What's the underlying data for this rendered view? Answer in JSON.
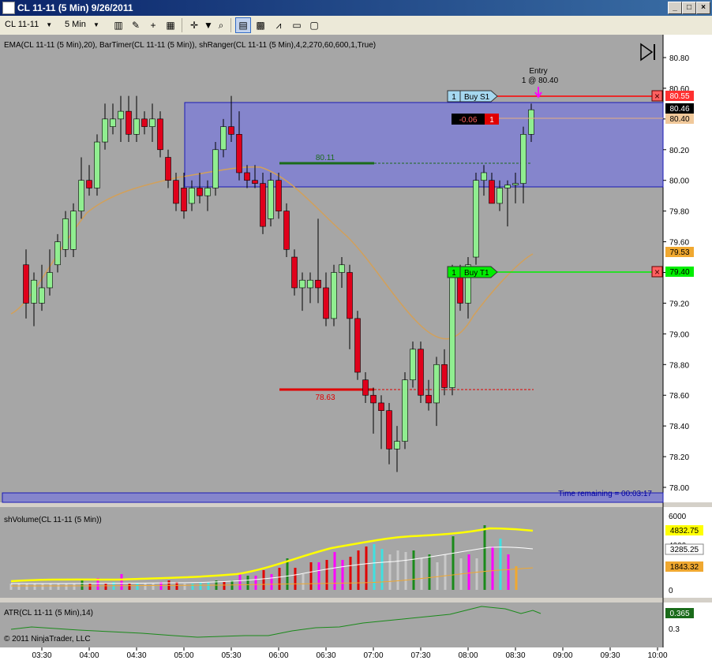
{
  "window": {
    "title": "CL 11-11 (5 Min)  9/26/2011",
    "minimize": "_",
    "maximize": "□",
    "close": "×"
  },
  "toolbar": {
    "instrument": "CL 11-11",
    "interval": "5 Min"
  },
  "price_panel": {
    "indicator_label": "EMA(CL 11-11 (5 Min),20), BarTimer(CL 11-11 (5 Min)), shRanger(CL 11-11 (5 Min),4,2,270,60,600,1,True)",
    "entry_label": "Entry",
    "entry_detail": "1 @ 80.40",
    "buy_s1": {
      "qty": "1",
      "label": "Buy S1",
      "price": "80.55"
    },
    "buy_t1": {
      "qty": "1",
      "label": "Buy T1",
      "price": "79.40"
    },
    "position": {
      "pnl": "-0.06",
      "qty": "1",
      "price": "80.40"
    },
    "last_price": "80.46",
    "ema_price": "79.53",
    "level_high": "80.11",
    "level_low": "78.63",
    "time_remaining": "Time remaining = 00:03:17",
    "y_ticks": [
      "80.80",
      "80.60",
      "80.40",
      "80.20",
      "80.00",
      "79.80",
      "79.60",
      "79.40",
      "79.20",
      "79.00",
      "78.80",
      "78.60",
      "78.40",
      "78.20",
      "78.00"
    ]
  },
  "volume_panel": {
    "label": "shVolume(CL 11-11 (5 Min))",
    "y_ticks": [
      "6000",
      "4000",
      "2000",
      "0"
    ],
    "yellow_value": "4832.75",
    "white_value": "3285.25",
    "orange_value": "1843.32"
  },
  "atr_panel": {
    "label": "ATR(CL 11-11 (5 Min),14)",
    "value": "0.365",
    "tick": "0.3",
    "copyright": "© 2011 NinjaTrader, LLC"
  },
  "x_ticks": [
    "03:30",
    "04:00",
    "04:30",
    "05:00",
    "05:30",
    "06:00",
    "06:30",
    "07:00",
    "07:30",
    "08:00",
    "08:30",
    "09:00",
    "09:30",
    "10:00"
  ],
  "colors": {
    "background": "#a6a6a6",
    "up_candle": "#90ee90",
    "down_candle": "#e0001b",
    "ema": "#d2a05a",
    "range_box": "#8080c8",
    "buy_target": "#00ff00",
    "stop": "#ff0000"
  },
  "chart_data": {
    "type": "candlestick",
    "ylim": [
      77.9,
      80.9
    ],
    "x_range": [
      "03:20",
      "10:05"
    ],
    "candles": [
      {
        "t": "03:20",
        "o": 79.45,
        "h": 79.55,
        "l": 79.1,
        "c": 79.2
      },
      {
        "t": "03:25",
        "o": 79.2,
        "h": 79.4,
        "l": 79.05,
        "c": 79.35
      },
      {
        "t": "03:30",
        "o": 79.2,
        "h": 79.45,
        "l": 79.15,
        "c": 79.3
      },
      {
        "t": "03:35",
        "o": 79.3,
        "h": 79.55,
        "l": 79.25,
        "c": 79.4
      },
      {
        "t": "03:40",
        "o": 79.45,
        "h": 79.65,
        "l": 79.4,
        "c": 79.6
      },
      {
        "t": "03:45",
        "o": 79.55,
        "h": 79.8,
        "l": 79.5,
        "c": 79.75
      },
      {
        "t": "03:50",
        "o": 79.55,
        "h": 79.85,
        "l": 79.5,
        "c": 79.8
      },
      {
        "t": "03:55",
        "o": 79.8,
        "h": 80.15,
        "l": 79.75,
        "c": 80.0
      },
      {
        "t": "04:00",
        "o": 80.0,
        "h": 80.1,
        "l": 79.9,
        "c": 79.95
      },
      {
        "t": "04:05",
        "o": 79.95,
        "h": 80.3,
        "l": 79.9,
        "c": 80.25
      },
      {
        "t": "04:10",
        "o": 80.25,
        "h": 80.5,
        "l": 80.2,
        "c": 80.4
      },
      {
        "t": "04:15",
        "o": 80.35,
        "h": 80.5,
        "l": 80.3,
        "c": 80.4
      },
      {
        "t": "04:20",
        "o": 80.4,
        "h": 80.55,
        "l": 80.25,
        "c": 80.45
      },
      {
        "t": "04:25",
        "o": 80.45,
        "h": 80.55,
        "l": 80.25,
        "c": 80.3
      },
      {
        "t": "04:30",
        "o": 80.3,
        "h": 80.55,
        "l": 80.25,
        "c": 80.4
      },
      {
        "t": "04:35",
        "o": 80.4,
        "h": 80.45,
        "l": 80.3,
        "c": 80.35
      },
      {
        "t": "04:40",
        "o": 80.35,
        "h": 80.5,
        "l": 80.25,
        "c": 80.4
      },
      {
        "t": "04:45",
        "o": 80.4,
        "h": 80.45,
        "l": 80.15,
        "c": 80.2
      },
      {
        "t": "04:50",
        "o": 80.15,
        "h": 80.2,
        "l": 79.95,
        "c": 80.0
      },
      {
        "t": "04:55",
        "o": 80.0,
        "h": 80.05,
        "l": 79.8,
        "c": 79.85
      },
      {
        "t": "05:00",
        "o": 79.95,
        "h": 80.05,
        "l": 79.75,
        "c": 79.8
      },
      {
        "t": "05:05",
        "o": 79.85,
        "h": 80.0,
        "l": 79.8,
        "c": 79.95
      },
      {
        "t": "05:10",
        "o": 79.95,
        "h": 80.05,
        "l": 79.85,
        "c": 79.9
      },
      {
        "t": "05:15",
        "o": 79.9,
        "h": 80.0,
        "l": 79.8,
        "c": 79.95
      },
      {
        "t": "05:20",
        "o": 79.95,
        "h": 80.25,
        "l": 79.9,
        "c": 80.2
      },
      {
        "t": "05:25",
        "o": 80.2,
        "h": 80.4,
        "l": 80.15,
        "c": 80.35
      },
      {
        "t": "05:30",
        "o": 80.35,
        "h": 80.55,
        "l": 80.25,
        "c": 80.3
      },
      {
        "t": "05:35",
        "o": 80.3,
        "h": 80.45,
        "l": 80.0,
        "c": 80.05
      },
      {
        "t": "05:40",
        "o": 80.05,
        "h": 80.1,
        "l": 79.95,
        "c": 80.0
      },
      {
        "t": "05:45",
        "o": 80.0,
        "h": 80.1,
        "l": 79.95,
        "c": 79.98
      },
      {
        "t": "05:50",
        "o": 79.98,
        "h": 80.05,
        "l": 79.65,
        "c": 79.7
      },
      {
        "t": "05:55",
        "o": 79.75,
        "h": 80.05,
        "l": 79.7,
        "c": 80.0
      },
      {
        "t": "06:00",
        "o": 80.0,
        "h": 80.05,
        "l": 79.75,
        "c": 79.8
      },
      {
        "t": "06:05",
        "o": 79.8,
        "h": 79.85,
        "l": 79.5,
        "c": 79.55
      },
      {
        "t": "06:10",
        "o": 79.5,
        "h": 79.55,
        "l": 79.25,
        "c": 79.3
      },
      {
        "t": "06:15",
        "o": 79.3,
        "h": 79.4,
        "l": 79.15,
        "c": 79.35
      },
      {
        "t": "06:20",
        "o": 79.3,
        "h": 79.4,
        "l": 79.2,
        "c": 79.35
      },
      {
        "t": "06:25",
        "o": 79.35,
        "h": 79.75,
        "l": 79.2,
        "c": 79.3
      },
      {
        "t": "06:30",
        "o": 79.3,
        "h": 79.4,
        "l": 79.05,
        "c": 79.1
      },
      {
        "t": "06:35",
        "o": 79.1,
        "h": 79.45,
        "l": 79.05,
        "c": 79.4
      },
      {
        "t": "06:40",
        "o": 79.4,
        "h": 79.5,
        "l": 79.3,
        "c": 79.45
      },
      {
        "t": "06:45",
        "o": 79.4,
        "h": 79.45,
        "l": 78.9,
        "c": 79.1
      },
      {
        "t": "06:50",
        "o": 79.1,
        "h": 79.15,
        "l": 78.7,
        "c": 78.75
      },
      {
        "t": "06:55",
        "o": 78.7,
        "h": 78.75,
        "l": 78.55,
        "c": 78.6
      },
      {
        "t": "07:00",
        "o": 78.6,
        "h": 78.65,
        "l": 78.35,
        "c": 78.55
      },
      {
        "t": "07:05",
        "o": 78.55,
        "h": 78.6,
        "l": 78.25,
        "c": 78.5
      },
      {
        "t": "07:10",
        "o": 78.5,
        "h": 78.55,
        "l": 78.15,
        "c": 78.25
      },
      {
        "t": "07:15",
        "o": 78.25,
        "h": 78.4,
        "l": 78.1,
        "c": 78.3
      },
      {
        "t": "07:20",
        "o": 78.3,
        "h": 78.75,
        "l": 78.25,
        "c": 78.7
      },
      {
        "t": "07:25",
        "o": 78.7,
        "h": 78.95,
        "l": 78.65,
        "c": 78.9
      },
      {
        "t": "07:30",
        "o": 78.9,
        "h": 78.95,
        "l": 78.55,
        "c": 78.6
      },
      {
        "t": "07:35",
        "o": 78.6,
        "h": 78.7,
        "l": 78.5,
        "c": 78.55
      },
      {
        "t": "07:40",
        "o": 78.55,
        "h": 78.85,
        "l": 78.4,
        "c": 78.8
      },
      {
        "t": "07:45",
        "o": 78.8,
        "h": 78.9,
        "l": 78.6,
        "c": 78.65
      },
      {
        "t": "07:50",
        "o": 78.65,
        "h": 79.45,
        "l": 78.6,
        "c": 79.4
      },
      {
        "t": "07:55",
        "o": 79.4,
        "h": 79.45,
        "l": 79.15,
        "c": 79.2
      },
      {
        "t": "08:00",
        "o": 79.2,
        "h": 79.5,
        "l": 79.1,
        "c": 79.45
      },
      {
        "t": "08:05",
        "o": 79.5,
        "h": 80.05,
        "l": 79.45,
        "c": 80.0
      },
      {
        "t": "08:10",
        "o": 80.0,
        "h": 80.1,
        "l": 79.9,
        "c": 80.05
      },
      {
        "t": "08:15",
        "o": 80.0,
        "h": 80.05,
        "l": 79.85,
        "c": 79.85
      },
      {
        "t": "08:20",
        "o": 79.85,
        "h": 80.0,
        "l": 79.8,
        "c": 79.95
      },
      {
        "t": "08:25",
        "o": 79.95,
        "h": 80.0,
        "l": 79.7,
        "c": 79.97
      },
      {
        "t": "08:30",
        "o": 79.97,
        "h": 80.05,
        "l": 79.85,
        "c": 79.98
      },
      {
        "t": "08:35",
        "o": 79.98,
        "h": 80.35,
        "l": 79.85,
        "c": 80.3
      },
      {
        "t": "08:40",
        "o": 80.3,
        "h": 80.5,
        "l": 80.25,
        "c": 80.46
      }
    ]
  }
}
